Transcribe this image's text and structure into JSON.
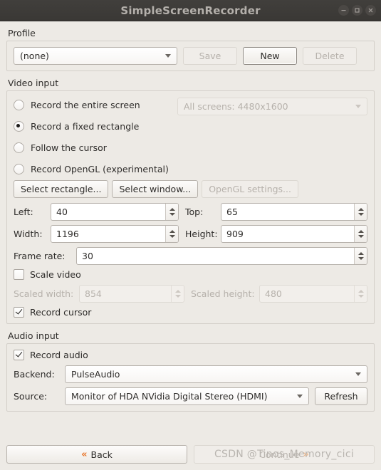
{
  "window": {
    "title": "SimpleScreenRecorder",
    "buttons": [
      {
        "name": "minimize-button",
        "glyph": "minimize"
      },
      {
        "name": "maximize-button",
        "glyph": "maximize"
      },
      {
        "name": "close-button",
        "glyph": "close"
      }
    ]
  },
  "profile": {
    "group_label": "Profile",
    "combo_value": "(none)",
    "save_label": "Save",
    "new_label": "New",
    "delete_label": "Delete"
  },
  "video_input": {
    "group_label": "Video input",
    "radios": [
      {
        "label": "Record the entire screen",
        "checked": false
      },
      {
        "label": "Record a fixed rectangle",
        "checked": true
      },
      {
        "label": "Follow the cursor",
        "checked": false
      },
      {
        "label": "Record OpenGL (experimental)",
        "checked": false
      }
    ],
    "screen_combo_value": "All screens: 4480x1600",
    "select_rectangle_label": "Select rectangle...",
    "select_window_label": "Select window...",
    "opengl_settings_label": "OpenGL settings...",
    "left_label": "Left:",
    "left_value": "40",
    "top_label": "Top:",
    "top_value": "65",
    "width_label": "Width:",
    "width_value": "1196",
    "height_label": "Height:",
    "height_value": "909",
    "frame_rate_label": "Frame rate:",
    "frame_rate_value": "30",
    "scale_video_label": "Scale video",
    "scale_video_checked": false,
    "scaled_width_label": "Scaled width:",
    "scaled_width_value": "854",
    "scaled_height_label": "Scaled height:",
    "scaled_height_value": "480",
    "record_cursor_label": "Record cursor",
    "record_cursor_checked": true
  },
  "audio_input": {
    "group_label": "Audio input",
    "record_audio_label": "Record audio",
    "record_audio_checked": true,
    "backend_label": "Backend:",
    "backend_value": "PulseAudio",
    "source_label": "Source:",
    "source_value": "Monitor of HDA NVidia Digital Stereo (HDMI)",
    "refresh_label": "Refresh"
  },
  "navigation": {
    "back_label": "Back",
    "back_chevron": "«",
    "continue_label": "Continue",
    "continue_chevron": "»",
    "watermark": "CSDN @Tinos_Memory_cici"
  },
  "colors": {
    "window_bg": "#edeae5",
    "titlebar_bg": "#3d3b38",
    "accent_orange": "#e8762c",
    "text": "#2e2c2a",
    "disabled_text": "#b6b1ab"
  }
}
